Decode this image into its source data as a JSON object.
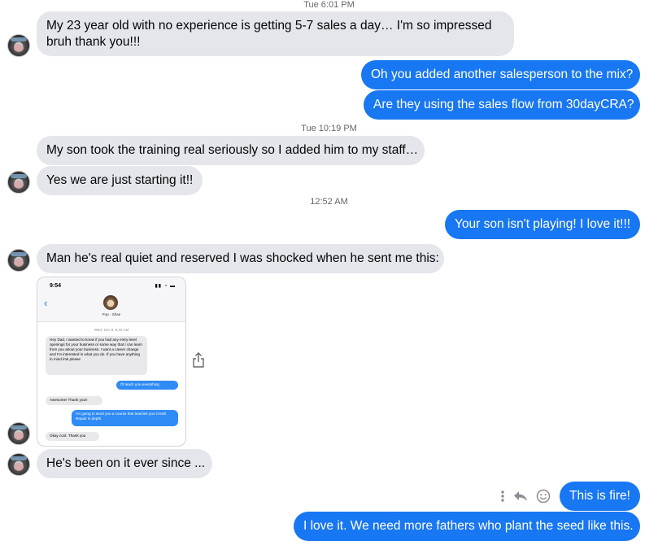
{
  "timestamps": [
    "Tue 6:01 PM",
    "Tue 10:19 PM",
    "12:52 AM"
  ],
  "messages": {
    "m1": "My 23 year old with no experience is getting 5-7 sales a day…  I'm so impressed bruh thank you!!!",
    "m1_line1": "My 23 year old with no experience is getting 5-7 sales a day…  I'm so impressed",
    "m1_line2": "bruh thank you!!!",
    "m2": "Oh you added another salesperson to the mix?",
    "m3": "Are they using the sales flow from 30dayCRA?",
    "m4": "My son took the training real seriously so I added him to my staff…",
    "m5": "Yes we are just starting it!!",
    "m6": "Your son isn't playing! I love it!!!",
    "m7": "Man he's real quiet and reserved I was shocked when he sent me this:",
    "m8": "He's been on it ever since ...",
    "m9": "This is fire!",
    "m10": "I love it. We need more fathers who plant the seed like this."
  },
  "phone": {
    "time": "9:54",
    "contact": "Pop - Shae",
    "date": "Wed, Dec 8, 8:32 AM",
    "msg1": "Hey Dad, I wanted to know if you had any entry level openings for your business or some way that I can learn from you about your business. I want a career change and I'm interested in what you do. If you have anything in mind lmk please",
    "msg2": "I'll teach you everything",
    "msg3": "Awesome! Thank you!!",
    "msg4": "I'm going to send you a course that teaches you Credit Repair in depth.",
    "msg5": "Okay cool. Thank you"
  },
  "icons": [
    "avatar",
    "share-icon",
    "more-icon",
    "reply-icon",
    "emoji-icon"
  ]
}
